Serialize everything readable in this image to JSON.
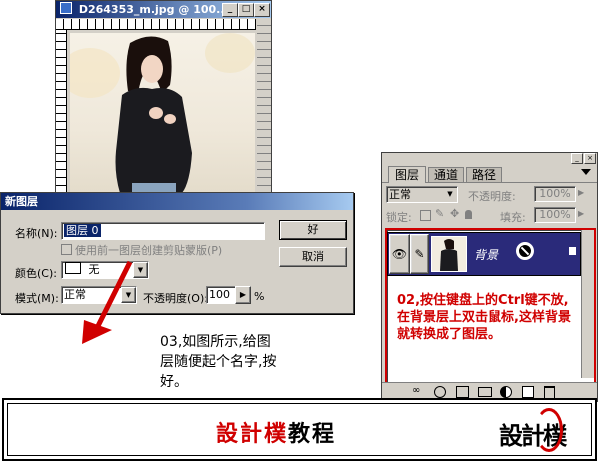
{
  "image_window": {
    "title": "D264353_m.jpg @ 100..."
  },
  "layers_panel": {
    "tabs": [
      {
        "label": "图层"
      },
      {
        "label": "通道"
      },
      {
        "label": "路径"
      }
    ],
    "blend_mode": "正常",
    "opacity_label": "不透明度:",
    "opacity_value": "100%",
    "lock_label": "锁定:",
    "fill_label": "填充:",
    "fill_value": "100%",
    "layer_name": "背景",
    "note": "02,按住键盘上的Ctrl键不放,在背景层上双击鼠标,这样背景就转换成了图层。"
  },
  "new_layer_dialog": {
    "title": "新图层",
    "name_label": "名称(N):",
    "name_value": "图层 0",
    "clipping_label": "使用前一图层创建剪贴蒙版(P)",
    "color_label": "颜色(C):",
    "color_value": "无",
    "mode_label": "模式(M):",
    "mode_value": "正常",
    "opacity_label": "不透明度(O):",
    "opacity_value": "100",
    "opacity_unit": "%",
    "ok_label": "好",
    "cancel_label": "取消"
  },
  "step_note": "03,如图所示,给图层随便起个名字,按好。",
  "banner": {
    "title_red": "設計樸",
    "title_black": "教程",
    "logo_text": "設計樸"
  },
  "colors": {
    "accent_red": "#d00000",
    "layer_selected": "#2a2a7a",
    "dialog_face": "#d4d0c8",
    "titlebar": "#0a246a"
  }
}
